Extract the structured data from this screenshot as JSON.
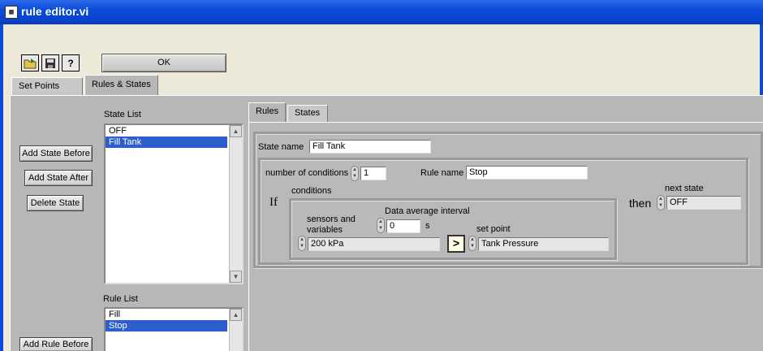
{
  "window": {
    "title": "rule editor.vi",
    "icon": "vi-icon"
  },
  "toolbar": {
    "icons": [
      "open-folder-icon",
      "save-disk-icon",
      "help-question-icon"
    ],
    "ok_label": "OK"
  },
  "outer_tabs": [
    {
      "label": "Set Points"
    },
    {
      "label": "Rules & States"
    }
  ],
  "state_panel": {
    "label": "State List",
    "items": [
      "OFF",
      "Fill Tank"
    ],
    "selected": "Fill Tank",
    "buttons": {
      "add_before": "Add State Before",
      "add_after": "Add State After",
      "delete": "Delete State"
    }
  },
  "rule_panel": {
    "label": "Rule List",
    "items": [
      "Fill",
      "Stop"
    ],
    "selected": "Stop",
    "buttons": {
      "add_before": "Add Rule Before"
    }
  },
  "inner_tabs": [
    {
      "label": "Rules"
    },
    {
      "label": "States"
    }
  ],
  "rule_editor": {
    "state_name_label": "State name",
    "state_name": "Fill Tank",
    "num_conditions_label": "number of conditions",
    "num_conditions": "1",
    "rule_name_label": "Rule name",
    "rule_name": "Stop",
    "if_label": "If",
    "conditions_label": "conditions",
    "sensors_label_1": "sensors and",
    "sensors_label_2": "variables",
    "sensor_value": "200 kPa",
    "avg_label": "Data average interval",
    "avg_value": "0",
    "avg_unit": "s",
    "comparator": ">",
    "set_point_label": "set point",
    "set_point_value": "Tank Pressure",
    "then_label": "then",
    "next_state_label": "next state",
    "next_state_value": "OFF"
  }
}
